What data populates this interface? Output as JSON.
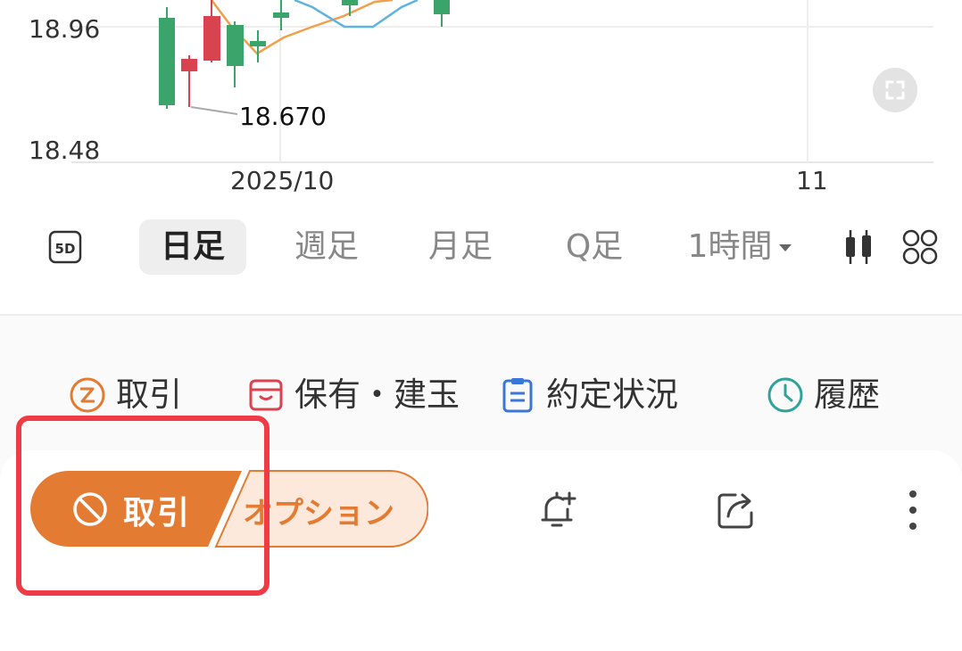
{
  "chart": {
    "y_labels": [
      "18.96",
      "18.48"
    ],
    "x_labels": [
      "2025/10",
      "11"
    ],
    "low_annotation": "18.670",
    "expand_icon": "expand-icon"
  },
  "timeframes": [
    {
      "label": "5D",
      "icon": "5d-icon"
    },
    {
      "label": "日足",
      "active": true
    },
    {
      "label": "週足"
    },
    {
      "label": "月足"
    },
    {
      "label": "Q足"
    },
    {
      "label": "1時間",
      "icon": "caret-down-icon"
    }
  ],
  "chart_tools": {
    "candle_icon": "candlestick-icon",
    "grid_icon": "grid-layout-icon"
  },
  "quick_actions": [
    {
      "label": "取引",
      "icon": "trade-circle-icon",
      "color": "#e47b33"
    },
    {
      "label": "保有・建玉",
      "icon": "archive-box-icon",
      "color": "#d9434f"
    },
    {
      "label": "約定状況",
      "icon": "clipboard-icon",
      "color": "#3b78d6"
    },
    {
      "label": "履歴",
      "icon": "clock-icon",
      "color": "#2fa39a"
    }
  ],
  "action_bar": {
    "trade_button": "取引",
    "trade_icon": "prohibited-icon",
    "option_tab": "オプション",
    "alert_icon": "bell-plus-icon",
    "share_icon": "share-icon",
    "more_icon": "more-vertical-icon"
  },
  "colors": {
    "accent": "#e47b33",
    "up": "#3aa46b",
    "down": "#d9434f",
    "highlight": "#ef3b45"
  }
}
